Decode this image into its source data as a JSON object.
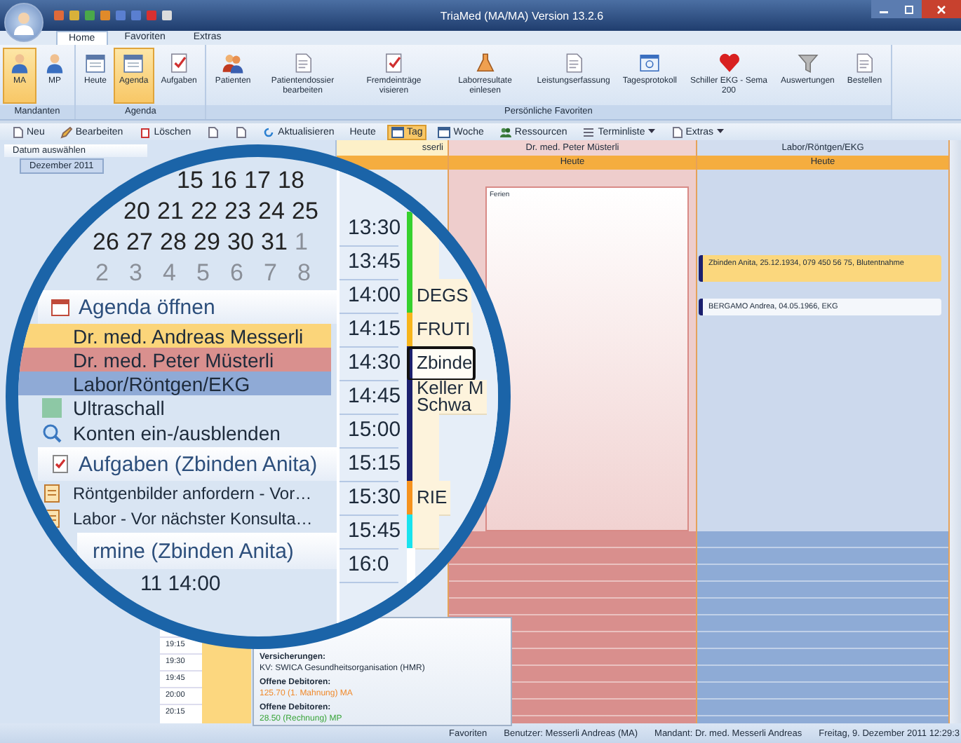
{
  "window": {
    "title": "TriaMed (MA/MA) Version 13.2.6"
  },
  "ribbon_tabs": [
    {
      "label": "Home",
      "selected": true
    },
    {
      "label": "Favoriten",
      "selected": false
    },
    {
      "label": "Extras",
      "selected": false
    }
  ],
  "ribbon_groups": [
    {
      "label": "Mandanten",
      "buttons": [
        {
          "label": "MA",
          "selected": true
        },
        {
          "label": "MP",
          "selected": false
        }
      ]
    },
    {
      "label": "Agenda",
      "buttons": [
        {
          "label": "Heute",
          "selected": false
        },
        {
          "label": "Agenda",
          "selected": true
        },
        {
          "label": "Aufgaben",
          "selected": false
        }
      ]
    },
    {
      "label": "Persönliche Favoriten",
      "buttons": [
        {
          "label": "Patienten",
          "selected": false
        },
        {
          "label": "Patientendossier bearbeiten",
          "selected": false
        },
        {
          "label": "Fremdeinträge visieren",
          "selected": false
        },
        {
          "label": "Laborresultate einlesen",
          "selected": false
        },
        {
          "label": "Leistungserfassung",
          "selected": false
        },
        {
          "label": "Tagesprotokoll",
          "selected": false
        },
        {
          "label": "Schiller EKG - Sema 200",
          "selected": false
        },
        {
          "label": "Auswertungen",
          "selected": false
        },
        {
          "label": "Bestellen",
          "selected": false
        }
      ]
    }
  ],
  "toolbar": [
    {
      "label": "Neu",
      "kind": "button",
      "selected": false
    },
    {
      "label": "Bearbeiten",
      "kind": "button",
      "selected": false
    },
    {
      "label": "Löschen",
      "kind": "button",
      "selected": false
    },
    {
      "kind": "icon",
      "selected": false
    },
    {
      "kind": "icon",
      "selected": false
    },
    {
      "label": "Aktualisieren",
      "kind": "button",
      "selected": false
    },
    {
      "label": "Heute",
      "kind": "text",
      "selected": false
    },
    {
      "label": "Tag",
      "kind": "button",
      "selected": true
    },
    {
      "label": "Woche",
      "kind": "button",
      "selected": false
    },
    {
      "label": "Ressourcen",
      "kind": "button",
      "selected": false
    },
    {
      "label": "Terminliste",
      "kind": "menu",
      "selected": false
    },
    {
      "label": "Extras",
      "kind": "menu",
      "selected": false
    }
  ],
  "left_pane": {
    "title": "Datum auswählen",
    "month": "Dezember 2011",
    "times": [
      "19:15",
      "19:30",
      "19:45",
      "20:00",
      "20:15"
    ]
  },
  "columns": [
    {
      "name": "sserli",
      "kind": "timeaxis",
      "color": "#fdf0c8"
    },
    {
      "name": "Dr. med. Peter Müsterli",
      "kind": "resource",
      "day": "Heute",
      "color": "#d98f8d",
      "events": [
        {
          "text": "Ferien",
          "kind": "block"
        }
      ]
    },
    {
      "name": "Labor/Röntgen/EKG",
      "kind": "resource",
      "day": "Heute",
      "color": "#8eabd6",
      "events": [
        {
          "text": "Zbinden Anita, 25.12.1934, 079 450 56 75, Blutentnahme",
          "kind": "appointment",
          "color": "#fbd77d"
        },
        {
          "text": "BERGAMO Andrea, 04.05.1966, EKG",
          "kind": "appointment",
          "color": "#f4f7fb"
        }
      ]
    }
  ],
  "popup": {
    "lines": [
      {
        "text": "Versicherungen:",
        "kind": "heading"
      },
      {
        "text": "KV: SWICA Gesundheitsorganisation (HMR)",
        "kind": "text"
      },
      {
        "text": "Offene Debitoren:",
        "kind": "heading"
      },
      {
        "text": "125.70 (1. Mahnung) MA",
        "kind": "text",
        "color": "#f08a2c"
      },
      {
        "text": "Offene Debitoren:",
        "kind": "heading"
      },
      {
        "text": "28.50 (Rechnung) MP",
        "kind": "text",
        "color": "#3aa53a"
      }
    ]
  },
  "magnifier": {
    "calendar_rows": [
      [
        {
          "day": "15",
          "muted": false
        },
        {
          "day": "16",
          "muted": false
        },
        {
          "day": "17",
          "muted": false
        },
        {
          "day": "18",
          "muted": false
        }
      ],
      [
        {
          "day": "20",
          "muted": false
        },
        {
          "day": "21",
          "muted": false
        },
        {
          "day": "22",
          "muted": false
        },
        {
          "day": "23",
          "muted": false
        },
        {
          "day": "24",
          "muted": false
        },
        {
          "day": "25",
          "muted": false
        }
      ],
      [
        {
          "day": "26",
          "muted": false
        },
        {
          "day": "27",
          "muted": false
        },
        {
          "day": "28",
          "muted": false
        },
        {
          "day": "29",
          "muted": false
        },
        {
          "day": "30",
          "muted": false
        },
        {
          "day": "31",
          "muted": false
        },
        {
          "day": "1",
          "muted": true
        }
      ],
      [
        {
          "day": "2",
          "muted": true
        },
        {
          "day": "3",
          "muted": true
        },
        {
          "day": "4",
          "muted": true
        },
        {
          "day": "5",
          "muted": true
        },
        {
          "day": "6",
          "muted": true
        },
        {
          "day": "7",
          "muted": true
        },
        {
          "day": "8",
          "muted": true
        }
      ]
    ],
    "agenda_header": "Agenda öffnen",
    "accounts": [
      {
        "label": "Dr. med. Andreas Messerli",
        "color": "#fbd57a",
        "visible": true
      },
      {
        "label": "Dr. med. Peter Müsterli",
        "color": "#d9908e",
        "visible": true
      },
      {
        "label": "Labor/Röntgen/EKG",
        "color": "#8faad6",
        "visible": true
      },
      {
        "label": "Ultraschall",
        "color": "#8dc8a5",
        "visible": false
      }
    ],
    "accounts_toggle": "Konten ein-/ausblenden",
    "tasks_header": "Aufgaben (Zbinden Anita)",
    "tasks": [
      "Röntgenbilder anfordern - Vor…",
      "Labor - Vor nächster Konsulta…"
    ],
    "appointments_header": "rmine (Zbinden Anita)",
    "appointment_time": "11 14:00",
    "slots": [
      {
        "time": "13:30",
        "color": "#36d12e",
        "selected": false
      },
      {
        "time": "13:45",
        "color": "#36d12e",
        "selected": false
      },
      {
        "time": "14:00",
        "color": "#36d12e",
        "lines": [
          "DEGS"
        ],
        "selected": false
      },
      {
        "time": "14:15",
        "color": "#f7b51c",
        "lines": [
          "FRUTI"
        ],
        "selected": false
      },
      {
        "time": "14:30",
        "color": "#1b1f6e",
        "lines": [
          "Zbinde"
        ],
        "selected": true
      },
      {
        "time": "14:45",
        "color": "#1b1f6e",
        "lines": [
          "Keller M",
          "Schwa"
        ],
        "selected": false
      },
      {
        "time": "15:00",
        "color": "#1b1f6e",
        "selected": false
      },
      {
        "time": "15:15",
        "color": "#1b1f6e",
        "selected": false
      },
      {
        "time": "15:30",
        "color": "#f5921e",
        "lines": [
          "RIE"
        ],
        "selected": false
      },
      {
        "time": "15:45",
        "color": "#19e3ee",
        "selected": false
      },
      {
        "time": "16:0",
        "selected": false
      }
    ]
  },
  "status_bar": [
    "Favoriten",
    "Benutzer: Messerli Andreas  (MA)",
    "Mandant: Dr. med. Messerli Andreas",
    "Freitag, 9. Dezember 2011 12:29:3"
  ]
}
